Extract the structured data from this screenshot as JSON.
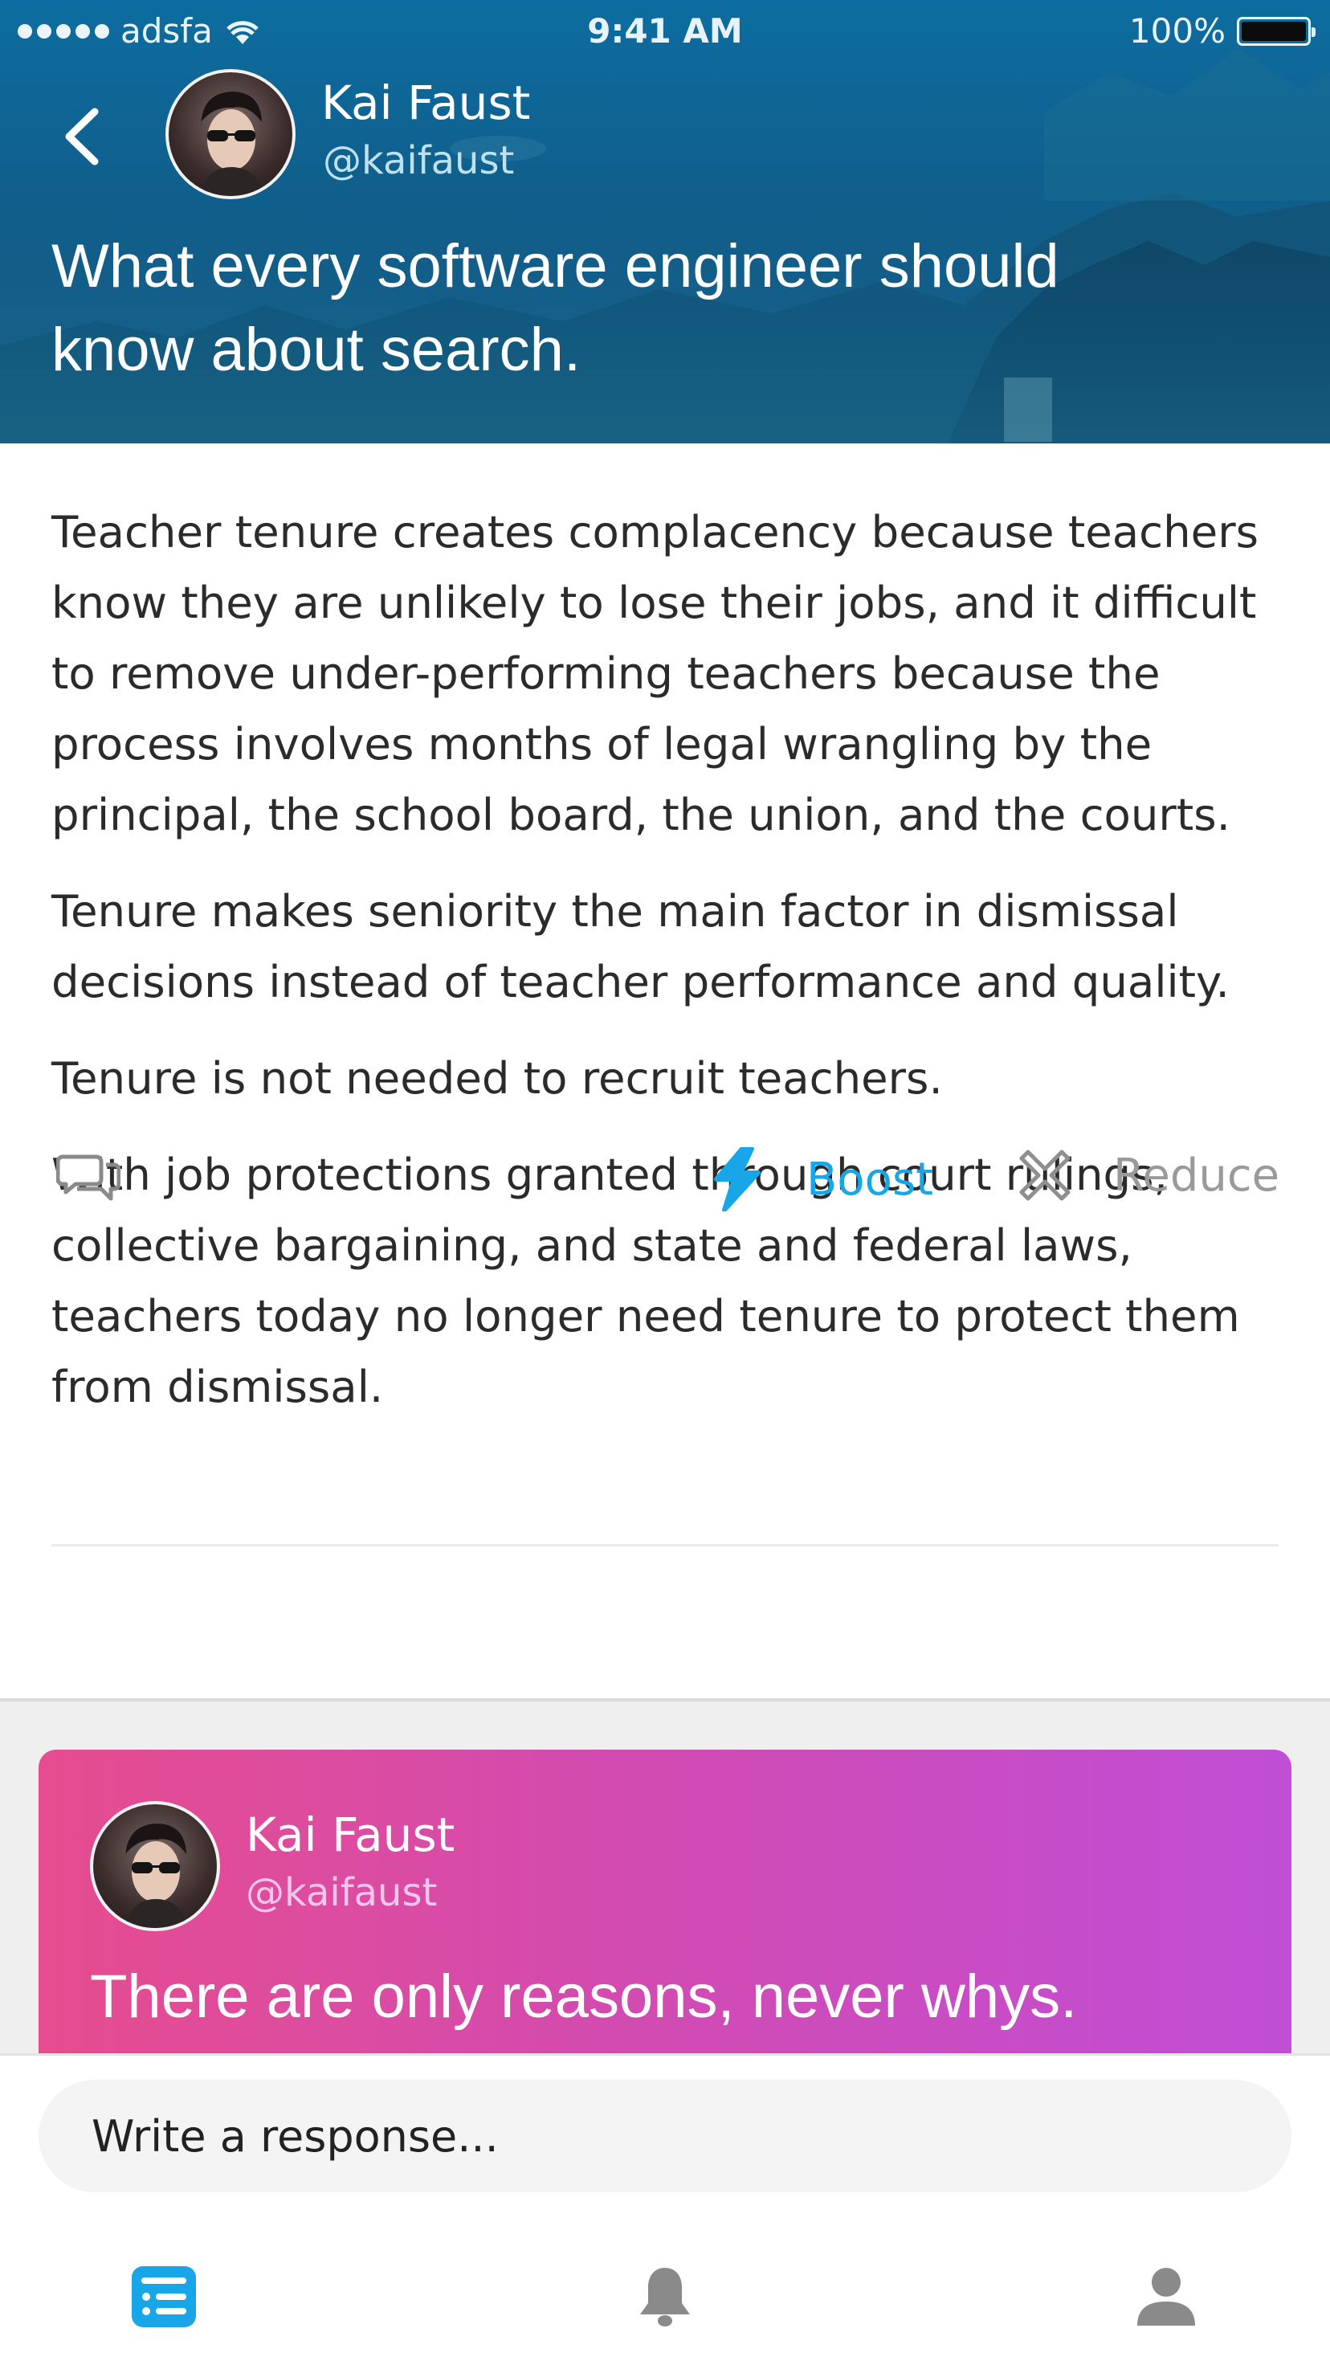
{
  "status_bar": {
    "carrier": "adsfa",
    "time": "9:41 AM",
    "battery": "100%"
  },
  "post": {
    "author_name": "Kai Faust",
    "author_handle": "@kaifaust",
    "title_line1": "What every software engineer should",
    "title_line2": "know about search.",
    "paragraphs": [
      "Teacher tenure creates complacency because teachers know they are unlikely to lose their jobs, and it difficult to remove under-performing teachers because the process involves months of legal wrangling by the principal, the school board, the union, and the courts.",
      "Tenure makes seniority the main factor in dismissal decisions instead of teacher performance and quality.",
      "Tenure is not needed to recruit teachers.",
      "With job protections granted through court rulings, collective bargaining, and state and federal laws, teachers today no longer need tenure to protect them from dismissal."
    ]
  },
  "actions": {
    "boost_label": "Boost",
    "reduce_label": "Reduce"
  },
  "card": {
    "author_name": "Kai Faust",
    "author_handle": "@kaifaust",
    "title": "There are only reasons, never whys."
  },
  "response": {
    "placeholder": "Write a response..."
  },
  "tabs": [
    "feed-icon",
    "bell-icon",
    "profile-icon"
  ],
  "colors": {
    "accent": "#19a6e8",
    "header": "#0f6a9a",
    "card_start": "#e64c8f",
    "card_end": "#c04ed6"
  }
}
